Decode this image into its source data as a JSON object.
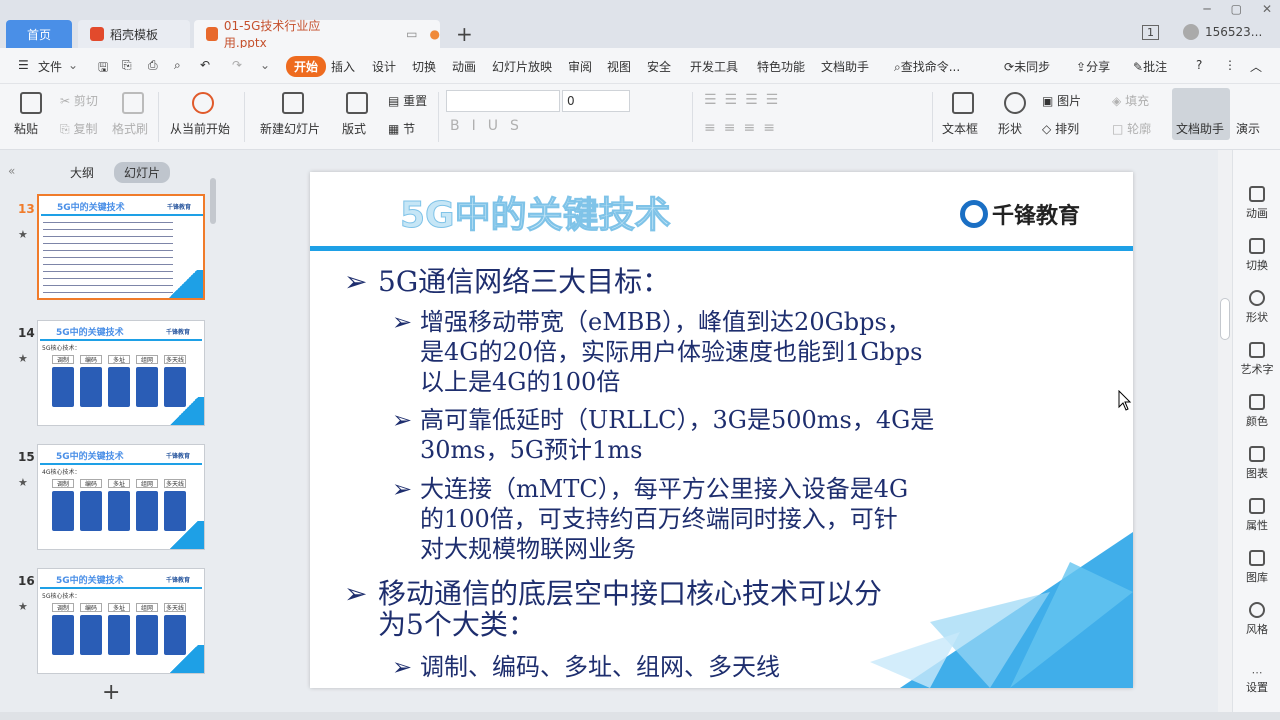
{
  "tabs": {
    "home": "首页",
    "daoke": "稻壳模板",
    "file": "01-5G技术行业应用.pptx"
  },
  "user": {
    "badge": "1",
    "name": "156523..."
  },
  "menu": {
    "file": "文件",
    "start": "开始",
    "items": [
      "插入",
      "设计",
      "切换",
      "动画",
      "幻灯片放映",
      "审阅",
      "视图",
      "安全",
      "开发工具",
      "特色功能",
      "文档助手"
    ],
    "search": "查找命令...",
    "sync": "未同步",
    "share": "分享",
    "annotate": "批注"
  },
  "ribbon": {
    "paste": "粘贴",
    "cut": "剪切",
    "copy": "复制",
    "format_painter": "格式刷",
    "from_current": "从当前开始",
    "new_slide": "新建幻灯片",
    "layout": "版式",
    "reset": "重置",
    "section": "节",
    "font_size": "0",
    "textbox": "文本框",
    "shape": "形状",
    "picture": "图片",
    "fill": "填充",
    "arrange": "排列",
    "outline": "轮廓",
    "doc_helper": "文档助手",
    "show": "演示"
  },
  "panel": {
    "outline": "大纲",
    "slides": "幻灯片"
  },
  "thumbs": [
    {
      "num": "13",
      "title": "5G中的关键技术",
      "logo": "千锋教育"
    },
    {
      "num": "14",
      "title": "5G中的关键技术",
      "logo": "千锋教育",
      "sub": "5G核心技术：",
      "cells": [
        "调制",
        "编码",
        "多址",
        "组网",
        "多天线"
      ]
    },
    {
      "num": "15",
      "title": "5G中的关键技术",
      "logo": "千锋教育",
      "sub": "4G核心技术：",
      "cells": [
        "调制",
        "编码",
        "多址",
        "组网",
        "多天线"
      ]
    },
    {
      "num": "16",
      "title": "5G中的关键技术",
      "logo": "千锋教育",
      "sub": "5G核心技术：",
      "cells": [
        "调制",
        "编码",
        "多址",
        "组网",
        "多天线"
      ]
    }
  ],
  "slide": {
    "title": "5G中的关键技术",
    "logo": "千锋教育",
    "b1": "5G通信网络三大目标：",
    "b1_1_l1": "增强移动带宽（eMBB），峰值到达20Gbps，",
    "b1_1_l2": "是4G的20倍，实际用户体验速度也能到1Gbps",
    "b1_1_l3": "以上是4G的100倍",
    "b1_2_l1": "高可靠低延时（URLLC），3G是500ms，4G是",
    "b1_2_l2": "30ms，5G预计1ms",
    "b1_3_l1": "大连接（mMTC），每平方公里接入设备是4G",
    "b1_3_l2": "的100倍，可支持约百万终端同时接入，可针",
    "b1_3_l3": "对大规模物联网业务",
    "b2_l1": "移动通信的底层空中接口核心技术可以分",
    "b2_l2": "为5个大类：",
    "b2_1": "调制、编码、多址、组网、多天线"
  },
  "rightbar": [
    "动画",
    "切换",
    "形状",
    "艺术字",
    "颜色",
    "图表",
    "属性",
    "图库",
    "风格",
    "设置"
  ],
  "colors": {
    "accent": "#1ea0e6",
    "text": "#1e2e6e",
    "start": "#ee6b1f"
  }
}
